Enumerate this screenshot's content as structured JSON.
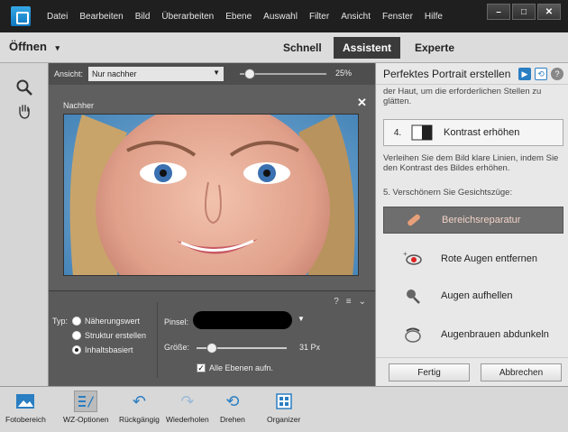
{
  "menu": [
    "Datei",
    "Bearbeiten",
    "Bild",
    "Überarbeiten",
    "Ebene",
    "Auswahl",
    "Filter",
    "Ansicht",
    "Fenster",
    "Hilfe"
  ],
  "window": {
    "min": "–",
    "max": "□",
    "close": "✕"
  },
  "modebar": {
    "open": "Öffnen",
    "open_arrow": "▾",
    "tabs": [
      "Schnell",
      "Assistent",
      "Experte"
    ],
    "active_tab": "Assistent"
  },
  "viewbar": {
    "label": "Ansicht:",
    "selected": "Nur nachher",
    "zoom": "25%",
    "zoom_level": 0.06
  },
  "canvas": {
    "label": "Nachher",
    "close": "✕"
  },
  "options": {
    "type_label": "Typ:",
    "types": [
      "Näherungswert",
      "Struktur erstellen",
      "Inhaltsbasiert"
    ],
    "selected_type": "Inhaltsbasiert",
    "brush_label": "Pinsel:",
    "size_label": "Größe:",
    "size_value": "31 Px",
    "size_fraction": 0.12,
    "all_layers": "Alle Ebenen aufn.",
    "all_layers_checked": true
  },
  "panel": {
    "title": "Perfektes Portrait erstellen",
    "intro_text": "der Haut, um die erforderlichen Stellen zu glätten.",
    "step4_num": "4.",
    "step4_label": "Kontrast erhöhen",
    "step4_desc": "Verleihen Sie dem Bild klare Linien, indem Sie den Kontrast des Bildes erhöhen.",
    "step5_title": "5. Verschönern Sie Gesichtszüge:",
    "tools": [
      "Bereichsreparatur",
      "Rote Augen entfernen",
      "Augen aufhellen",
      "Augenbrauen abdunkeln"
    ],
    "active_tool": "Bereichsreparatur",
    "done": "Fertig",
    "cancel": "Abbrechen"
  },
  "bottombar": [
    "Fotobereich",
    "WZ-Optionen",
    "Rückgängig",
    "Wiederholen",
    "Drehen",
    "Organizer"
  ],
  "colors": {
    "accent": "#2a7ec2",
    "active_tab": "#3a3a3a",
    "active_tool_bg": "#6e6e6e"
  }
}
